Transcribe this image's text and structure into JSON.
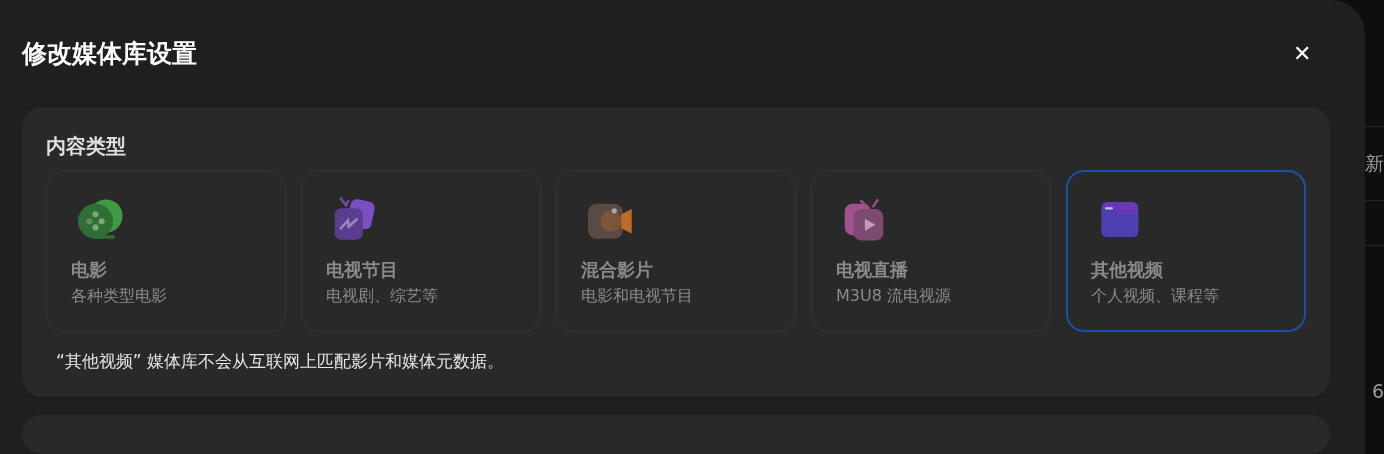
{
  "dialog": {
    "title": "修改媒体库设置",
    "close": "✕"
  },
  "content_type": {
    "heading": "内容类型",
    "options": [
      {
        "kind": "movie",
        "title": "电影",
        "subtitle": "各种类型电影",
        "selected": false
      },
      {
        "kind": "tv",
        "title": "电视节目",
        "subtitle": "电视剧、综艺等",
        "selected": false
      },
      {
        "kind": "mixed",
        "title": "混合影片",
        "subtitle": "电影和电视节目",
        "selected": false
      },
      {
        "kind": "live",
        "title": "电视直播",
        "subtitle": "M3U8 流电视源",
        "selected": false
      },
      {
        "kind": "other",
        "title": "其他视频",
        "subtitle": "个人视频、课程等",
        "selected": true
      }
    ],
    "note": "“其他视频” 媒体库不会从互联网上匹配影片和媒体元数据。"
  },
  "background_page": {
    "texts": [
      "新",
      "6"
    ]
  }
}
